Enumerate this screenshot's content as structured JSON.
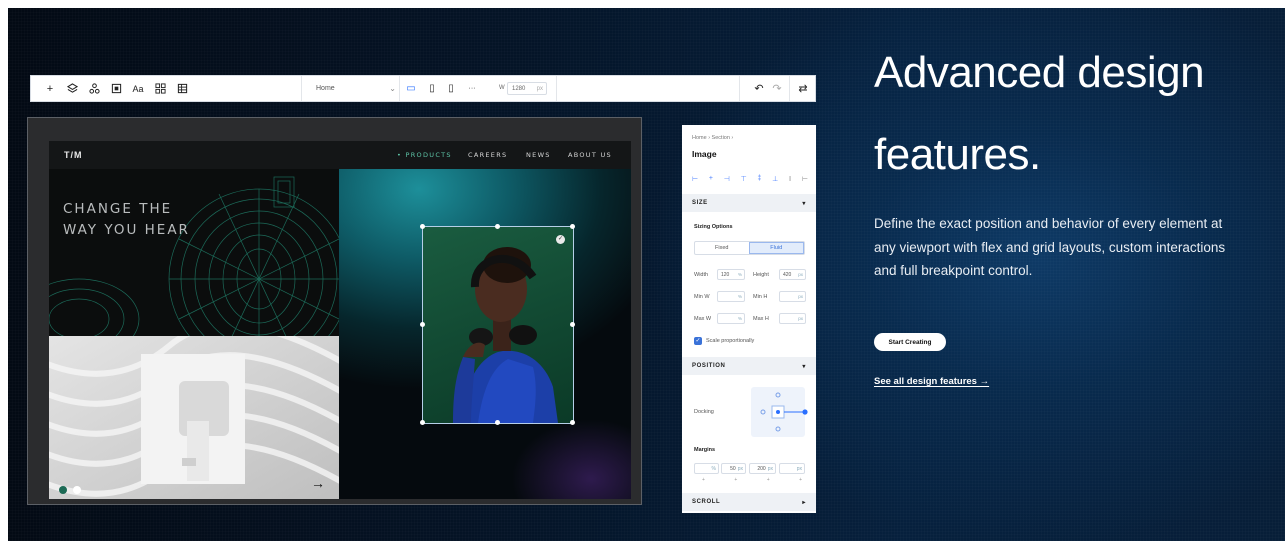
{
  "hero": {
    "title_line1": "Advanced design",
    "title_line2": "features.",
    "description": "Define the exact position and behavior of every element at any viewport with flex and grid layouts, custom interactions and full breakpoint control.",
    "cta_label": "Start Creating",
    "link_label": "See all design features →"
  },
  "editor": {
    "toolbar": {
      "icons": [
        "plus-icon",
        "layers-icon",
        "components-icon",
        "media-icon",
        "text-icon",
        "apps-icon",
        "table-icon"
      ],
      "page_select": "Home",
      "width_label": "W",
      "width_value": "1280",
      "width_unit": "px",
      "more": "···"
    },
    "site": {
      "logo": "T/M",
      "nav": [
        "• PRODUCTS",
        "CAREERS",
        "NEWS",
        "ABOUT US"
      ],
      "headline_line1": "CHANGE THE",
      "headline_line2": "WAY YOU HEAR",
      "arrow": "→"
    },
    "inspector": {
      "breadcrumb": "Home  ›  Section  ›",
      "title": "Image",
      "size_section": "SIZE",
      "sizing_options": "Sizing Options",
      "fixed": "Fixed",
      "fluid": "Fluid",
      "width_label": "Width",
      "width_value": "120",
      "width_unit": "%",
      "height_label": "Height",
      "height_value": "420",
      "height_unit": "px",
      "min_w": "Min W",
      "min_h": "Min H",
      "max_w": "Max W",
      "max_h": "Max H",
      "percent": "%",
      "px": "px",
      "scale_label": "Scale proportionally",
      "position_section": "POSITION",
      "docking": "Docking",
      "margins": "Margins",
      "margin_top": "50",
      "margin_right": "200",
      "scroll_section": "SCROLL"
    }
  },
  "colors": {
    "accent": "#2a6fff",
    "nav_active": "#5ec6a8",
    "photo_green": "#145138",
    "hero_bg": "#06203d"
  }
}
